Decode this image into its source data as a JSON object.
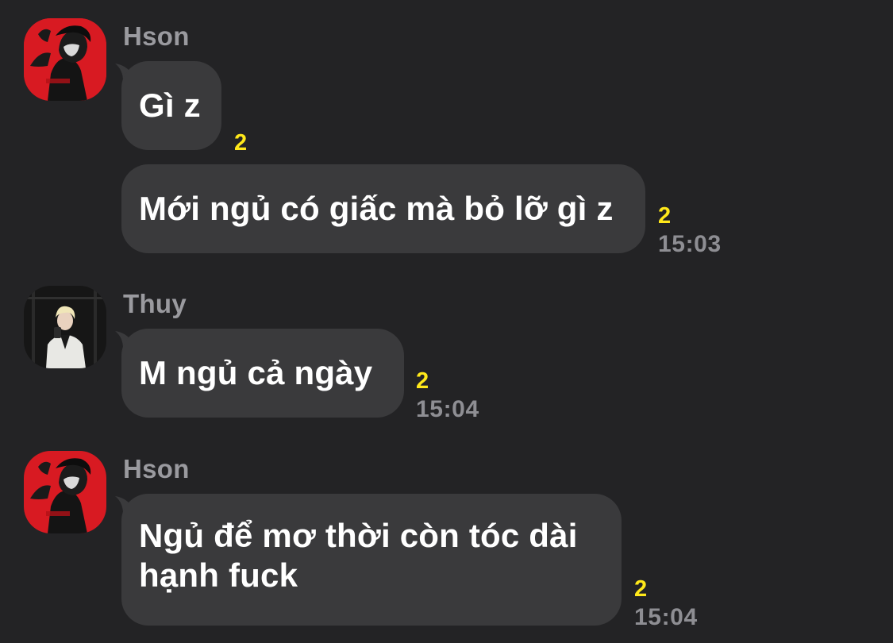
{
  "messages": [
    {
      "sender": "Hson",
      "text": "Gì z",
      "count": "2",
      "time": ""
    },
    {
      "sender": "",
      "text": "Mới ngủ có giấc mà bỏ lỡ gì z",
      "count": "2",
      "time": "15:03"
    },
    {
      "sender": "Thuy",
      "text": "M ngủ cả ngày",
      "count": "2",
      "time": "15:04"
    },
    {
      "sender": "Hson",
      "text_line1": "Ngủ để mơ thời còn tóc dài",
      "text_line2": "hạnh fuck",
      "count": "2",
      "time": "15:04"
    }
  ],
  "colors": {
    "background": "#232325",
    "bubble": "#3a3a3c",
    "sender_name": "#9a9a9f",
    "count_badge": "#ffe81a",
    "timestamp": "#8e8e93"
  },
  "icons": {
    "hson_avatar": "avatar-photo-red",
    "thuy_avatar": "avatar-photo-dark"
  }
}
